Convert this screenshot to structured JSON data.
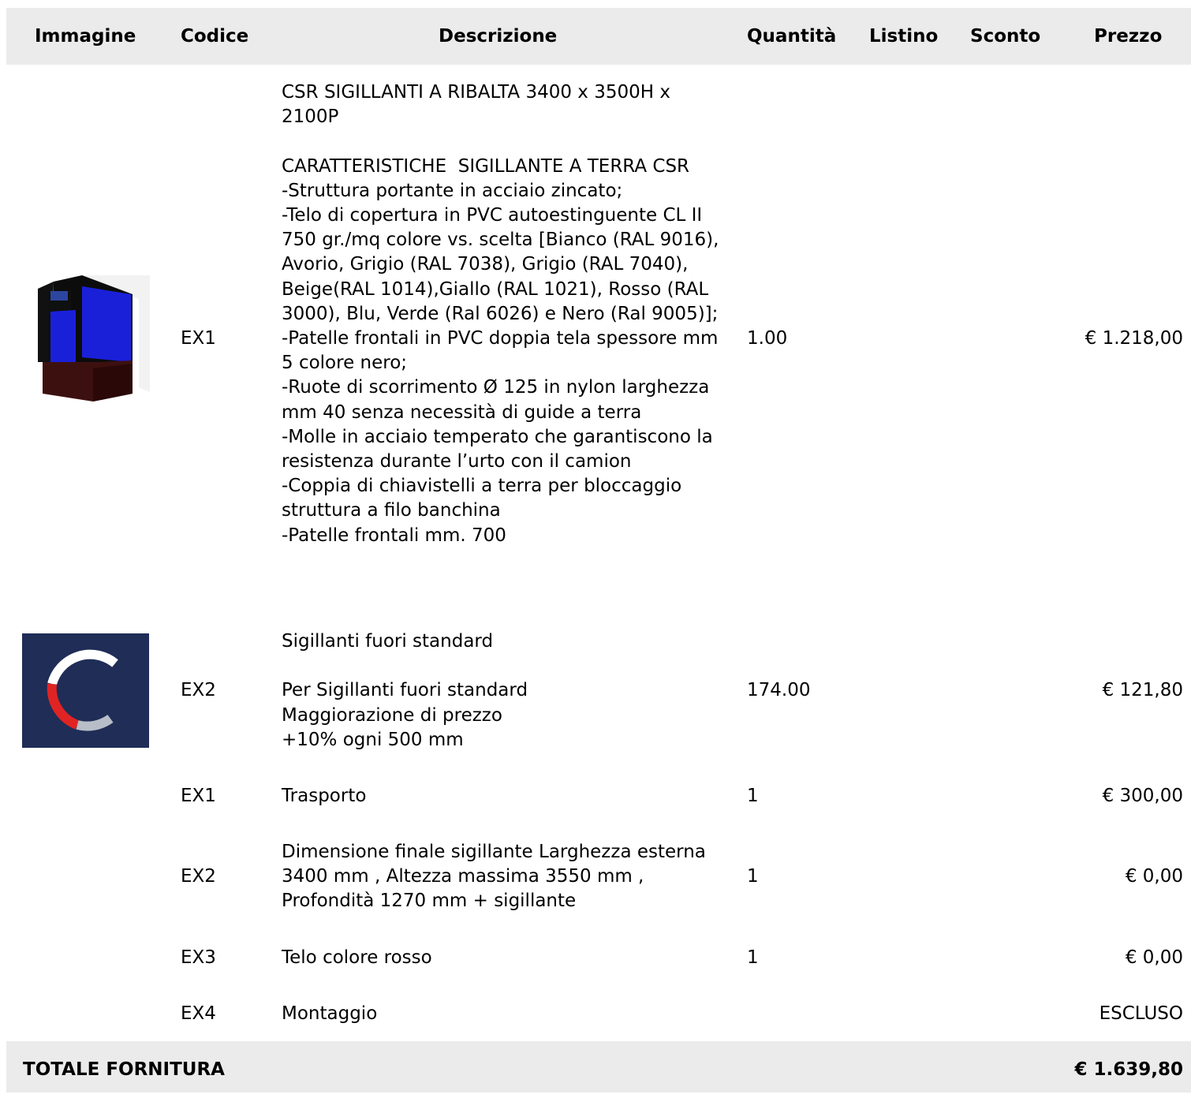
{
  "header": {
    "immagine": "Immagine",
    "codice": "Codice",
    "descrizione": "Descrizione",
    "quantita": "Quantità",
    "listino": "Listino",
    "sconto": "Sconto",
    "prezzo": "Prezzo"
  },
  "rows": [
    {
      "code": "EX1",
      "description": "CSR SIGILLANTI A RIBALTA 3400 x 3500H x 2100P\n\nCARATTERISTICHE  SIGILLANTE A TERRA CSR\n-Struttura portante in acciaio zincato;\n-Telo di copertura in PVC autoestinguente CL II 750 gr./mq colore vs. scelta [Bianco (RAL 9016), Avorio, Grigio (RAL 7038), Grigio (RAL 7040), Beige(RAL 1014),Giallo (RAL 1021), Rosso (RAL 3000), Blu, Verde (Ral 6026) e Nero (Ral 9005)];\n-Patelle frontali in PVC doppia tela spessore mm 5 colore nero;\n-Ruote di scorrimento Ø 125 in nylon larghezza mm 40 senza necessità di guide a terra\n-Molle in acciaio temperato che garantiscono la resistenza durante l’urto con il camion\n-Coppia di chiavistelli a terra per bloccaggio struttura a filo banchina\n-Patelle frontali mm. 700",
      "quantity": "1.00",
      "price": "€ 1.218,00"
    },
    {
      "code": "EX2",
      "description": "Sigillanti fuori standard\n\nPer Sigillanti fuori standard\nMaggiorazione di prezzo\n+10% ogni 500 mm",
      "quantity": "174.00",
      "price": "€ 121,80"
    },
    {
      "code": "EX1",
      "description": "Trasporto",
      "quantity": "1",
      "price": "€ 300,00"
    },
    {
      "code": "EX2",
      "description": "Dimensione finale sigillante Larghezza esterna 3400 mm , Altezza massima 3550 mm , Profondità 1270 mm + sigillante",
      "quantity": "1",
      "price": "€ 0,00"
    },
    {
      "code": "EX3",
      "description": "Telo colore rosso",
      "quantity": "1",
      "price": "€ 0,00"
    },
    {
      "code": "EX4",
      "description": "Montaggio",
      "quantity": "",
      "price": "ESCLUSO"
    }
  ],
  "footer": {
    "label": "TOTALE FORNITURA",
    "total": "€ 1.639,80"
  },
  "colors": {
    "header_bg": "#ebebeb",
    "logo_bg": "#1f2d57",
    "logo_red": "#e02424",
    "seal_blue": "#1a20d8"
  },
  "icons": {
    "row1_image": "dock-seal-product-image",
    "row2_image": "company-logo-image"
  }
}
